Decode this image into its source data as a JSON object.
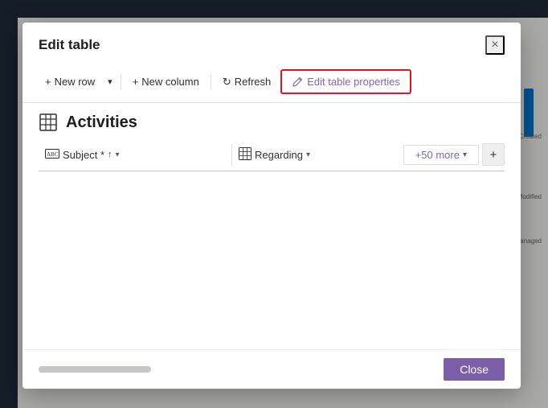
{
  "app": {
    "background_color": "#1e2a3a"
  },
  "modal": {
    "title": "Edit table",
    "close_label": "×",
    "toolbar": {
      "new_row_label": "New row",
      "dropdown_label": "▾",
      "new_column_label": "New column",
      "refresh_label": "Refresh",
      "edit_table_label": "Edit table properties"
    },
    "table": {
      "name": "Activities",
      "columns": [
        {
          "label": "Subject *",
          "has_sort": true,
          "sort_direction": "↑"
        },
        {
          "label": "Regarding",
          "has_dropdown": true
        }
      ],
      "more_label": "+50 more",
      "add_label": "+"
    },
    "footer": {
      "close_label": "Close"
    }
  },
  "bg": {
    "labels": [
      "Created",
      "Modified",
      "Managed"
    ]
  }
}
